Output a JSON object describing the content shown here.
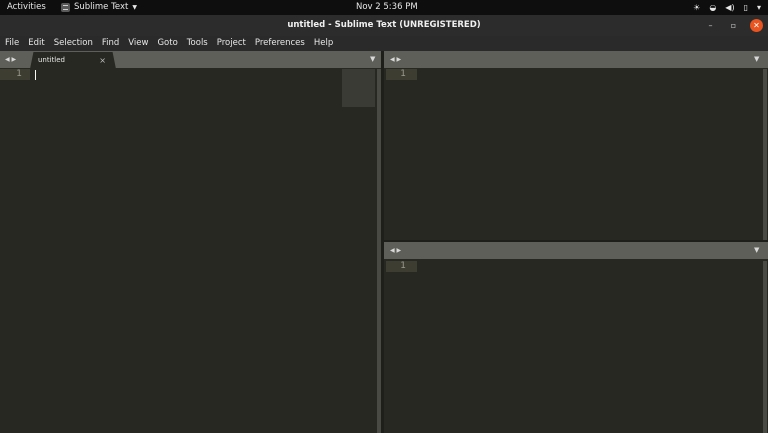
{
  "topbar": {
    "activities": "Activities",
    "app_name": "Sublime Text",
    "clock": "Nov 2   5:36 PM",
    "tray_icons": [
      "brightness-icon",
      "wifi-icon",
      "volume-icon",
      "battery-icon",
      "system-menu-icon"
    ]
  },
  "window": {
    "title": "untitled - Sublime Text (UNREGISTERED)",
    "buttons": [
      "minimize",
      "maximize",
      "close"
    ]
  },
  "menu": {
    "items": [
      "File",
      "Edit",
      "Selection",
      "Find",
      "View",
      "Goto",
      "Tools",
      "Project",
      "Preferences",
      "Help"
    ]
  },
  "panes": {
    "left": {
      "tab_label": "untitled",
      "line_number": "1"
    },
    "top_right": {
      "line_number": "1"
    },
    "bottom_right": {
      "line_number": "1"
    }
  },
  "colors": {
    "editor_bg": "#272822",
    "tabstrip_bg": "#5e5f59",
    "close_button": "#e95420"
  }
}
